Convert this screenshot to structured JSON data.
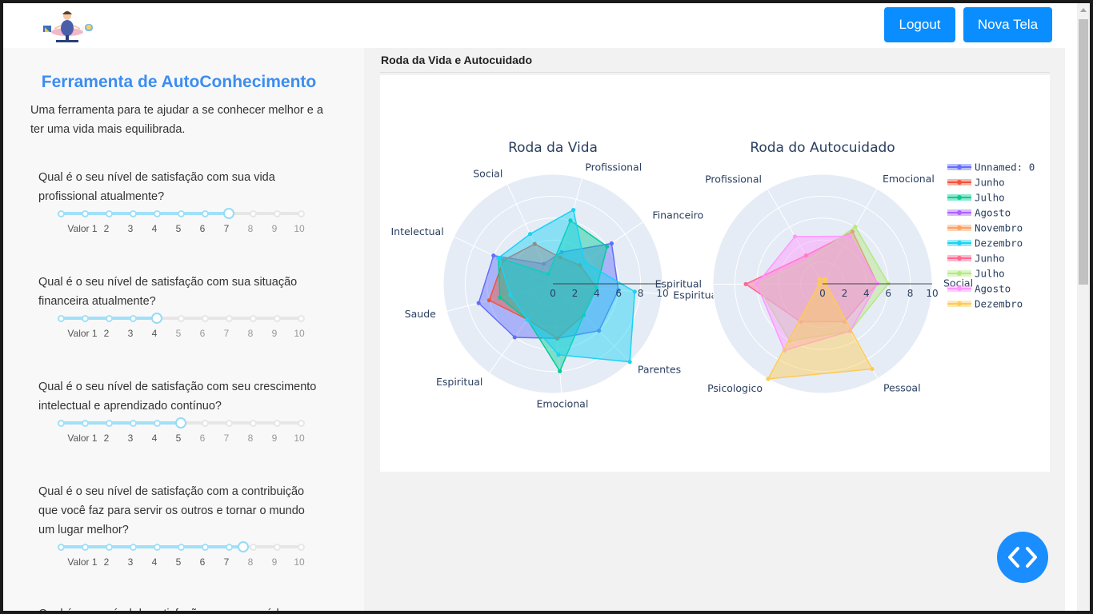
{
  "header": {
    "logout_label": "Logout",
    "nova_tela_label": "Nova Tela"
  },
  "sidebar": {
    "title": "Ferramenta de AutoConhecimento",
    "description": "Uma ferramenta para te ajudar a se conhecer melhor e a ter uma vida mais equilibrada.",
    "first_mark_label": "Valor 1",
    "marks": [
      "2",
      "3",
      "4",
      "5",
      "6",
      "7",
      "8",
      "9",
      "10"
    ],
    "questions": [
      {
        "text": "Qual é o seu nível de satisfação com sua vida profissional atualmente?",
        "value": 7.0
      },
      {
        "text": "Qual é o seu nível de satisfação com sua situação financeira atualmente?",
        "value": 4.0
      },
      {
        "text": "Qual é o seu nível de satisfação com seu crescimento intelectual e aprendizado contínuo?",
        "value": 5.0
      },
      {
        "text": "Qual é o seu nível de satisfação com a contribuição que você faz para servir os outros e tornar o mundo um lugar melhor?",
        "value": 7.6
      },
      {
        "text": "Qual é o seu nível de satisfação com sua saúde",
        "value": null
      }
    ]
  },
  "main": {
    "section_title": "Roda da Vida e Autocuidado"
  },
  "chart_data": [
    {
      "type": "radar",
      "title": "Roda da Vida",
      "axes": [
        "Profissional",
        "Financeiro",
        "Espiritual",
        "Parentes",
        "Emocional",
        "Espiritual",
        "Saude",
        "Intelectual",
        "Social"
      ],
      "radial_ticks": [
        "0",
        "2",
        "4",
        "6",
        "8",
        "10"
      ],
      "radial_range": [
        0,
        10
      ],
      "series": [
        {
          "name": "Unnamed: 0",
          "color": "#636efa",
          "values": [
            3.0,
            6.5,
            6.0,
            6.0,
            5.0,
            6.0,
            7.0,
            6.0,
            2.0
          ]
        },
        {
          "name": "Junho",
          "color": "#ef553b",
          "values": [
            2.5,
            3.0,
            4.0,
            4.0,
            5.0,
            4.0,
            6.0,
            5.0,
            4.0
          ]
        },
        {
          "name": "Julho",
          "color": "#00cc96",
          "values": [
            6.0,
            6.0,
            4.0,
            4.0,
            8.0,
            4.0,
            5.0,
            5.5,
            1.0
          ]
        },
        {
          "name": "Dezembro",
          "color": "#19d3f3",
          "values": [
            7.0,
            3.5,
            7.5,
            10.0,
            6.5,
            4.0,
            4.0,
            5.5,
            5.0
          ]
        }
      ]
    },
    {
      "type": "radar",
      "title": "Roda do Autocuidado",
      "axes": [
        "Emocional",
        "Social",
        "Pessoal",
        "Psicologico",
        "Espiritual",
        "Profissional"
      ],
      "radial_ticks": [
        "0",
        "2",
        "4",
        "6",
        "8",
        "10"
      ],
      "radial_range": [
        0,
        10
      ],
      "series": [
        {
          "name": "Junho",
          "color": "#ff6692",
          "values": [
            5.5,
            5.0,
            4.0,
            4.0,
            7.0,
            3.0
          ]
        },
        {
          "name": "Julho",
          "color": "#b6e880",
          "values": [
            6.0,
            6.0,
            5.0,
            6.0,
            6.0,
            2.5
          ]
        },
        {
          "name": "Agosto",
          "color": "#ff97ff",
          "values": [
            5.0,
            5.0,
            5.0,
            7.0,
            6.0,
            5.0
          ]
        },
        {
          "name": "Dezembro",
          "color": "#fecb52",
          "values": [
            0.5,
            0.3,
            9.0,
            10.0,
            0.3,
            0.5
          ]
        }
      ]
    }
  ],
  "legend": [
    {
      "name": "Unnamed: 0",
      "color": "#636efa"
    },
    {
      "name": "Junho",
      "color": "#ef553b"
    },
    {
      "name": "Julho",
      "color": "#00cc96"
    },
    {
      "name": "Agosto",
      "color": "#ab63fa"
    },
    {
      "name": "Novembro",
      "color": "#ffa15a"
    },
    {
      "name": "Dezembro",
      "color": "#19d3f3"
    },
    {
      "name": "Junho",
      "color": "#ff6692"
    },
    {
      "name": "Julho",
      "color": "#b6e880"
    },
    {
      "name": "Agosto",
      "color": "#ff97ff"
    },
    {
      "name": "Dezembro",
      "color": "#fecb52"
    }
  ],
  "icons": {
    "logo": "meditation-logo",
    "code": "code-brackets-icon"
  }
}
